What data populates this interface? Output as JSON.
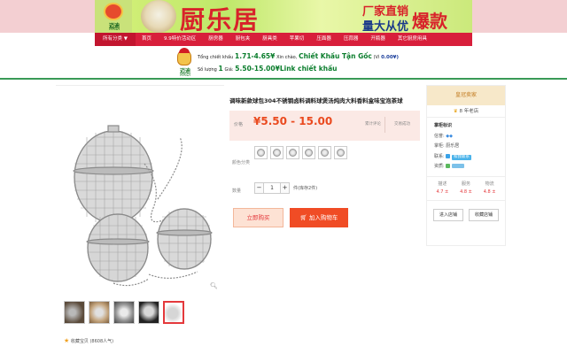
{
  "banner": {
    "logo_brand": "迈迪",
    "logo_sub": "MAIDI",
    "brand_name": "厨乐居",
    "slogan_line1": "厂家直销",
    "slogan_line2": "量大从优",
    "slogan_big": "爆款"
  },
  "nav": {
    "items": [
      {
        "label": "所有分类 ▼"
      },
      {
        "label": "首页"
      },
      {
        "label": "9.9特价活动区"
      },
      {
        "label": "厨房器"
      },
      {
        "label": "厨包夹"
      },
      {
        "label": "厨具类"
      },
      {
        "label": "苹果切"
      },
      {
        "label": "压面器"
      },
      {
        "label": "压蒜器"
      },
      {
        "label": "开瓶器"
      },
      {
        "label": "其它厨房用具"
      }
    ]
  },
  "promo": {
    "mascot_label": "迈迪",
    "mascot_sub": "MAIDI",
    "line1_label": "Tổng chiết khấu",
    "line1_value": "1.71-4.65¥",
    "line1_text": "Xin chào,",
    "line1_link": "Chiết Khấu Tận Gốc",
    "line1_vi": "(Vì",
    "line1_vi_value": "0.00¥)",
    "line2_label": "Số lượng",
    "line2_qty": "1",
    "line2_unit": "Giá:",
    "line2_price": "5.50-15.00¥Link chiết khấu"
  },
  "product": {
    "title": "调味新款球包304不锈钢卤料调料球煲汤炖肉大料香料盒味宝泡茶球",
    "price_label": "价格",
    "price": "¥5.50 - 15.00",
    "stat1": "累计评论",
    "stat2": "交易成功",
    "color_label": "颜色分类",
    "quantity_label": "数量",
    "quantity_value": "1",
    "quantity_unit": "件(库存2件)",
    "buy_now": "立即购买",
    "add_to_cart": "加入购物车",
    "favorite": "收藏宝贝",
    "favorite_count": "(8608人气)",
    "zoom_icon": "magnifier-icon"
  },
  "seller": {
    "header": "皇冠卖家",
    "years": "8 年老店",
    "shop_label": "掌柜标识",
    "credit_label": "信誉:",
    "owner_label": "掌柜:",
    "owner_value": "厨乐居",
    "contact_label": "联系:",
    "contact_value": "和我联系",
    "quality_label": "资质:",
    "scores": [
      {
        "label": "描述",
        "value": "4.7 ±"
      },
      {
        "label": "服务",
        "value": "4.8 ±"
      },
      {
        "label": "物流",
        "value": "4.8 ±"
      }
    ],
    "enter_shop": "进入店铺",
    "favorite_shop": "收藏店铺"
  }
}
